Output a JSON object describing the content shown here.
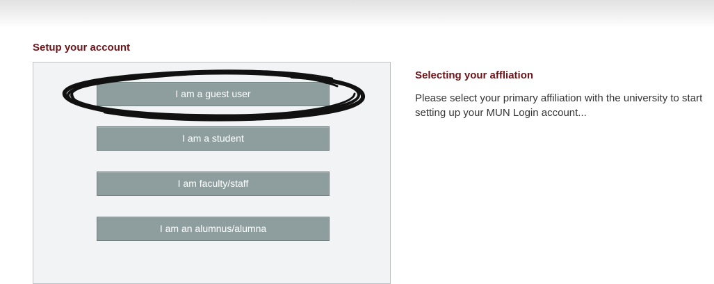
{
  "setup": {
    "title": "Setup your account"
  },
  "affiliation_buttons": {
    "guest": "I am a guest user",
    "student": "I am a student",
    "faculty": "I am faculty/staff",
    "alumni": "I am an alumnus/alumna"
  },
  "info": {
    "title": "Selecting your affliation",
    "text": "Please select your primary affiliation with the university to start setting up your MUN Login account..."
  },
  "colors": {
    "heading": "#6e1419",
    "button_bg": "#8e9e9f",
    "panel_bg": "#f1f3f4",
    "annotation": "#111111"
  },
  "annotation": {
    "icon": "hand-drawn-circle-icon"
  }
}
